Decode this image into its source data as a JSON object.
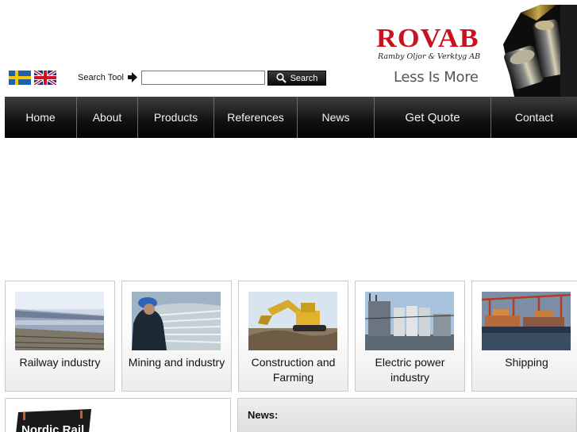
{
  "header": {
    "flags": [
      {
        "name": "swedish-flag-icon",
        "colors": {
          "field": "#1f5fad",
          "cross": "#f3c800"
        }
      },
      {
        "name": "uk-flag-icon",
        "colors": {
          "field": "#1b2f7a",
          "cross": "#d0102b"
        }
      }
    ],
    "search": {
      "label": "Search Tool",
      "placeholder": "",
      "value": "",
      "button_label": "Search"
    },
    "logo": {
      "name": "ROVAB",
      "subtitle": "Ramby Oljor & Verktyg AB",
      "color": "#c8121f"
    },
    "tagline": "Less Is More"
  },
  "nav": {
    "items": [
      {
        "label": "Home"
      },
      {
        "label": "About"
      },
      {
        "label": "Products"
      },
      {
        "label": "References"
      },
      {
        "label": "News"
      },
      {
        "label": "Get Quote"
      },
      {
        "label": "Contact"
      }
    ]
  },
  "industries": [
    {
      "label": "Railway industry"
    },
    {
      "label": "Mining and industry"
    },
    {
      "label": "Construction and Farming"
    },
    {
      "label": "Electric power industry"
    },
    {
      "label": "Shipping"
    }
  ],
  "partner": {
    "logo_text": "Nordic Rail"
  },
  "news": {
    "title": "News:"
  }
}
